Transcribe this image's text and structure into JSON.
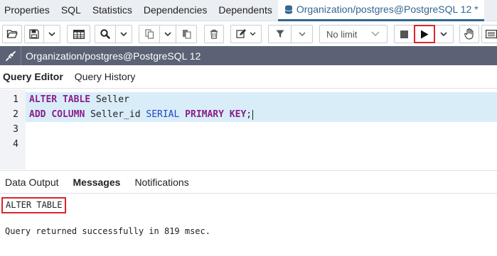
{
  "tabs": [
    {
      "label": "Properties"
    },
    {
      "label": "SQL"
    },
    {
      "label": "Statistics"
    },
    {
      "label": "Dependencies"
    },
    {
      "label": "Dependents"
    },
    {
      "label": "Organization/postgres@PostgreSQL 12 *",
      "active": true,
      "icon": "database-icon"
    }
  ],
  "toolbar": {
    "limit_placeholder": "No limit",
    "icons": [
      "open-file-icon",
      "save-icon",
      "chevron-down-icon",
      "table-grid-icon",
      "search-icon",
      "chevron-down-icon",
      "copy-icon",
      "chevron-down-icon",
      "paste-icon",
      "delete-icon",
      "edit-icon",
      "chevron-down-icon",
      "filter-icon",
      "chevron-down-icon",
      "stop-icon",
      "execute-icon",
      "chevron-down-icon",
      "hand-icon",
      "keyboard-icon"
    ],
    "highlight_color": "#d9262c"
  },
  "connection": {
    "label": "Organization/postgres@PostgreSQL 12",
    "icon": "connection-icon"
  },
  "editor_tabs": [
    {
      "label": "Query Editor",
      "active": true
    },
    {
      "label": "Query History"
    }
  ],
  "editor": {
    "line_numbers": [
      "1",
      "2",
      "3",
      "4"
    ],
    "line1": {
      "kw1": "ALTER",
      "kw2": "TABLE",
      "ident": " Seller"
    },
    "line2": {
      "kw1": "ADD",
      "kw2": "COLUMN",
      "ident": " Seller_id ",
      "type": "SERIAL",
      "kw3": "PRIMARY",
      "kw4": "KEY",
      "punct": ";"
    }
  },
  "result_tabs": [
    {
      "label": "Data Output"
    },
    {
      "label": "Messages",
      "active": true
    },
    {
      "label": "Notifications"
    }
  ],
  "messages": {
    "command": "ALTER TABLE",
    "result": "Query returned successfully in 819 msec."
  },
  "colors": {
    "accent": "#326690",
    "connection_bar": "#5b6275",
    "keyword": "#8a1e88",
    "type": "#1f46c8",
    "selection": "#d9edf9"
  }
}
